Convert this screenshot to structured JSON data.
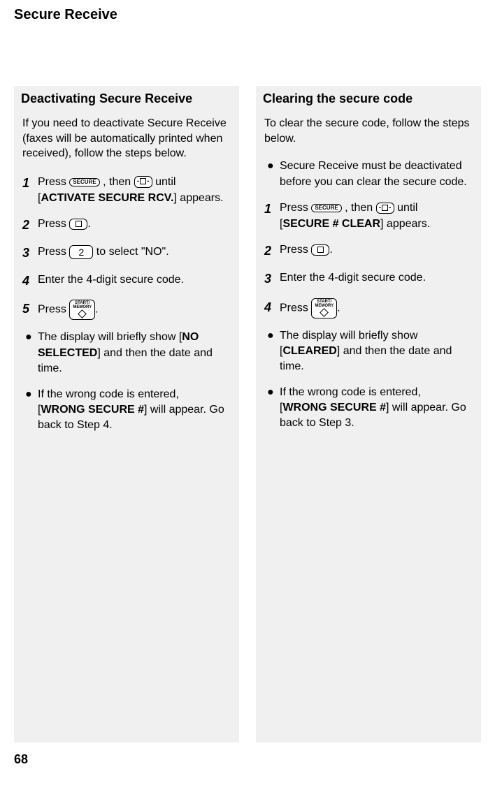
{
  "header": "Secure Receive",
  "page_number": "68",
  "left": {
    "title": "Deactivating Secure Receive",
    "intro": "If you need to deactivate Secure Receive (faxes will be automatically printed when received), follow the steps below.",
    "steps": [
      {
        "num": "1",
        "pre": "Press ",
        "key1": "SECURE",
        "mid": " , then ",
        "key2": "nav",
        "post": " until [",
        "bold": "ACTIVATE SECURE RCV.",
        "after": "] appears."
      },
      {
        "num": "2",
        "pre": "Press ",
        "key1": "nav-center",
        "after": "."
      },
      {
        "num": "3",
        "pre": "Press ",
        "key1": "2",
        "post": " to select \"NO\"."
      },
      {
        "num": "4",
        "pre": "Enter the 4-digit secure code."
      },
      {
        "num": "5",
        "pre": "Press ",
        "key1": "START/MEMORY",
        "after": "."
      }
    ],
    "bullets": [
      {
        "pre": "The display will briefly show [",
        "bold": "NO SELECTED",
        "post": "] and then the date and time."
      },
      {
        "pre": "If the wrong code is entered, [",
        "bold": "WRONG SECURE #",
        "post": "] will appear. Go back to Step 4."
      }
    ]
  },
  "right": {
    "title": "Clearing the secure code",
    "intro": "To clear the secure code, follow the steps below.",
    "prebullet": {
      "text": "Secure Receive must be deactivated before you can clear the secure code."
    },
    "steps": [
      {
        "num": "1",
        "pre": "Press ",
        "key1": "SECURE",
        "mid": " , then ",
        "key2": "nav",
        "post": " until [",
        "bold": "SECURE # CLEAR",
        "after": "] appears."
      },
      {
        "num": "2",
        "pre": "Press ",
        "key1": "nav-center",
        "after": "."
      },
      {
        "num": "3",
        "pre": "Enter the 4-digit secure code."
      },
      {
        "num": "4",
        "pre": "Press ",
        "key1": "START/MEMORY",
        "after": "."
      }
    ],
    "bullets": [
      {
        "pre": "The display will briefly show [",
        "bold": "CLEARED",
        "post": "] and then the date and time."
      },
      {
        "pre": "If the wrong code is entered, [",
        "bold": "WRONG SECURE #",
        "post": "] will appear. Go back to Step 3."
      }
    ]
  }
}
